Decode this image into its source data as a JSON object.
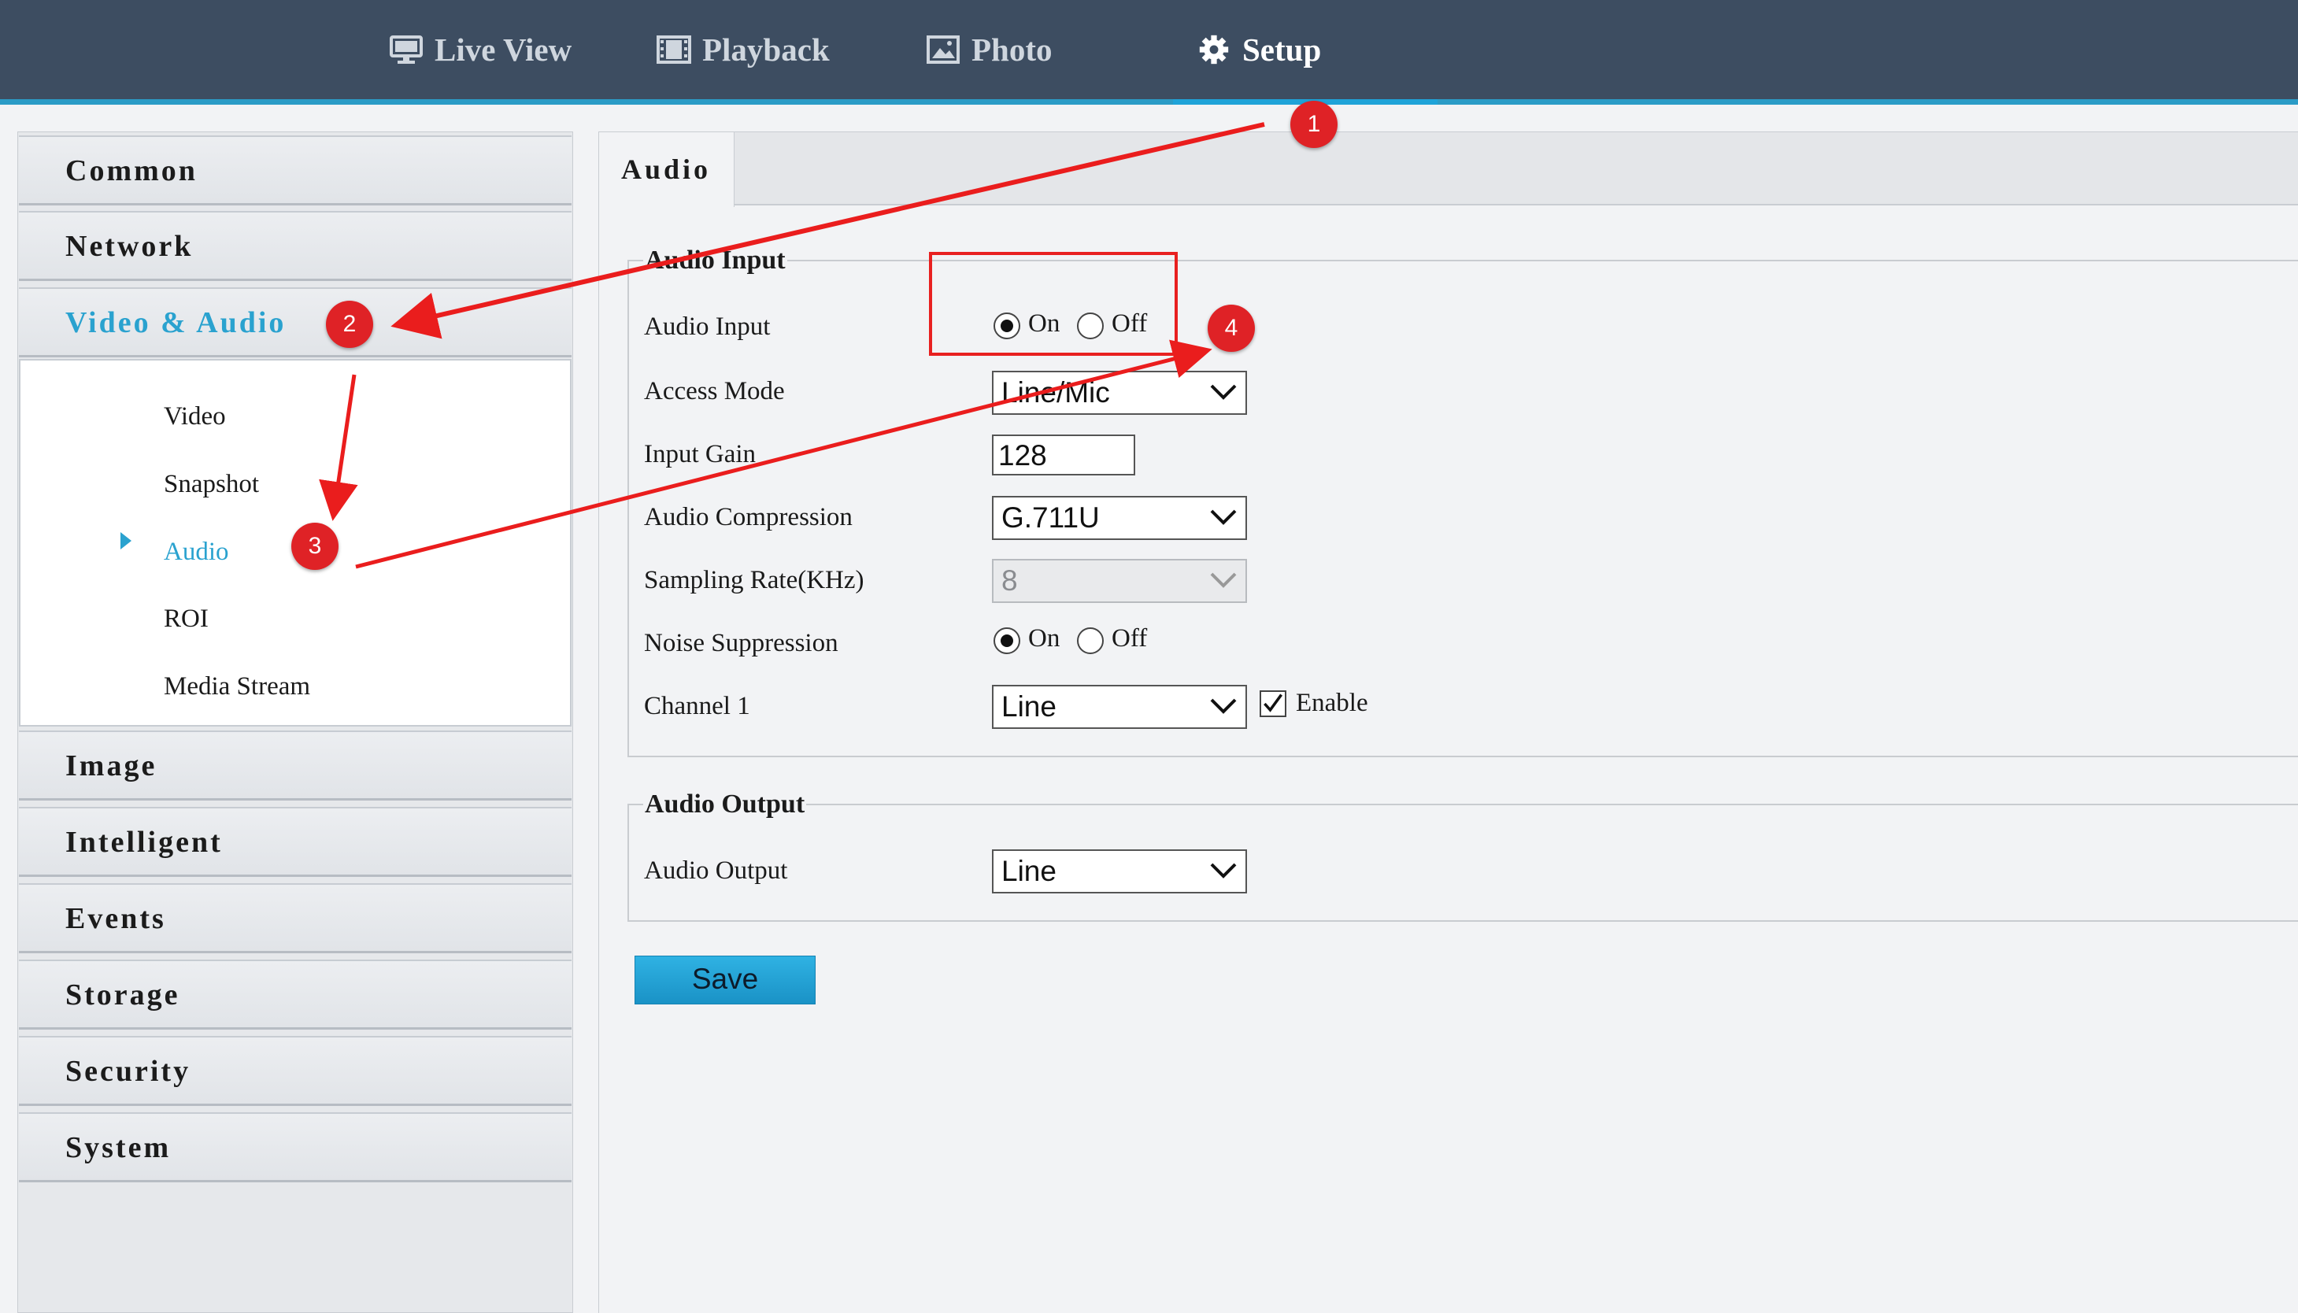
{
  "topnav": {
    "items": [
      {
        "label": "Live View",
        "icon": "monitor-icon"
      },
      {
        "label": "Playback",
        "icon": "film-icon"
      },
      {
        "label": "Photo",
        "icon": "picture-icon"
      },
      {
        "label": "Setup",
        "icon": "gear-icon"
      }
    ],
    "active": "Setup"
  },
  "sidebar": {
    "menus": [
      "Common",
      "Network",
      "Video & Audio",
      "Image",
      "Intelligent",
      "Events",
      "Storage",
      "Security",
      "System"
    ],
    "active_menu": "Video & Audio",
    "submenu": [
      "Video",
      "Snapshot",
      "Audio",
      "ROI",
      "Media Stream"
    ],
    "active_submenu": "Audio"
  },
  "tab": {
    "label": "Audio"
  },
  "audio_input": {
    "legend": "Audio Input",
    "audio_input": {
      "label": "Audio Input",
      "on": "On",
      "off": "Off",
      "selected": "On"
    },
    "access_mode": {
      "label": "Access Mode",
      "value": "Line/Mic"
    },
    "input_gain": {
      "label": "Input Gain",
      "value": "128"
    },
    "audio_compression": {
      "label": "Audio Compression",
      "value": "G.711U"
    },
    "sampling_rate": {
      "label": "Sampling Rate(KHz)",
      "value": "8"
    },
    "noise_suppression": {
      "label": "Noise Suppression",
      "on": "On",
      "off": "Off",
      "selected": "On"
    },
    "channel": {
      "label": "Channel 1",
      "value": "Line",
      "enable_label": "Enable",
      "enabled": true
    }
  },
  "audio_output": {
    "legend": "Audio Output",
    "label": "Audio Output",
    "value": "Line"
  },
  "save_label": "Save",
  "annotations": {
    "badges": [
      "1",
      "2",
      "3",
      "4"
    ],
    "color": "#df2226"
  },
  "colors": {
    "topbar": "#3d4d61",
    "accent": "#2aa2cf",
    "save_button": "#1fa3d8"
  }
}
